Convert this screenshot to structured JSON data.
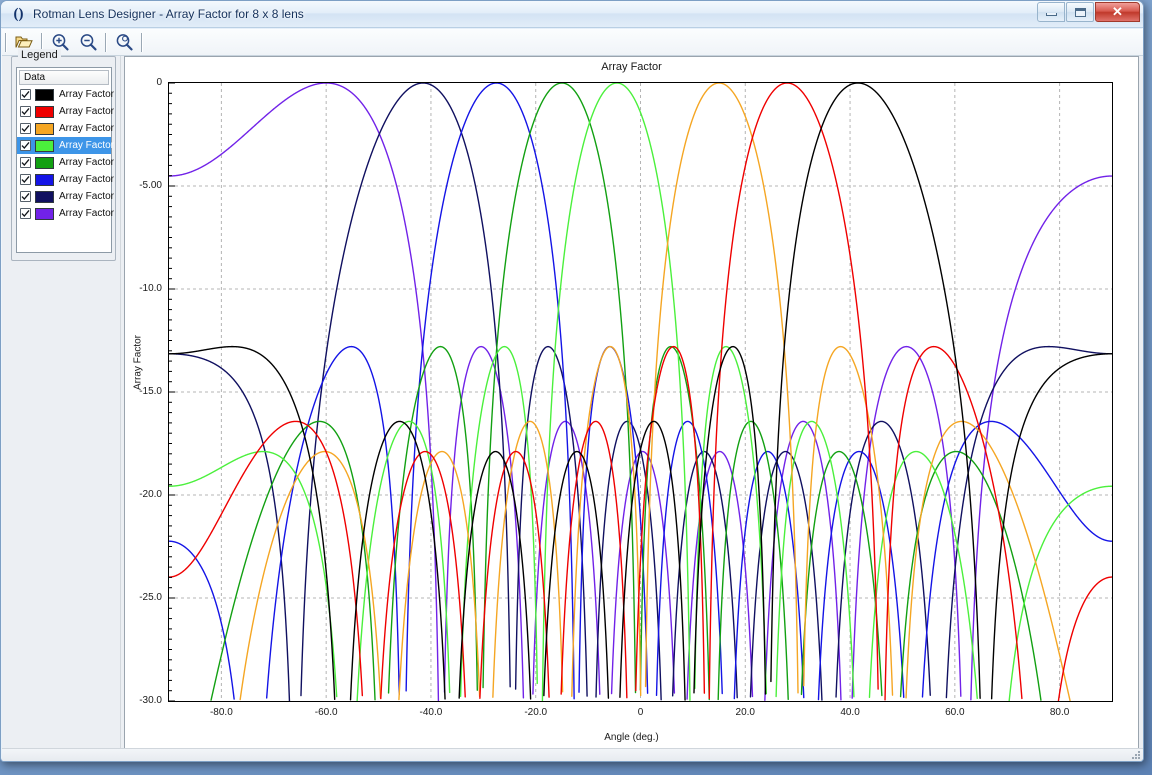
{
  "window": {
    "title": "Rotman Lens Designer - Array Factor for 8 x 8 lens",
    "icon": "lens-icon",
    "minimize_label": "Minimize",
    "maximize_label": "Maximize",
    "close_label": "✕"
  },
  "toolbar": {
    "buttons": [
      {
        "name": "open-file-button",
        "icon": "open-folder-icon",
        "tooltip": "Open"
      },
      {
        "name": "zoom-in-button",
        "icon": "zoom-in-icon",
        "tooltip": "Zoom In"
      },
      {
        "name": "zoom-out-button",
        "icon": "zoom-out-icon",
        "tooltip": "Zoom Out"
      },
      {
        "name": "zoom-reset-button",
        "icon": "zoom-reset-icon",
        "tooltip": "Reset Zoom"
      }
    ]
  },
  "legend": {
    "caption": "Legend",
    "column_header": "Data",
    "selected_index": 3,
    "items": [
      {
        "label": "Array Factor",
        "color": "#000000",
        "checked": true
      },
      {
        "label": "Array Factor",
        "color": "#ef0000",
        "checked": true
      },
      {
        "label": "Array Factor",
        "color": "#f5a623",
        "checked": true
      },
      {
        "label": "Array Factor",
        "color": "#4bf03c",
        "checked": true
      },
      {
        "label": "Array Factor",
        "color": "#12a012",
        "checked": true
      },
      {
        "label": "Array Factor",
        "color": "#1414e6",
        "checked": true
      },
      {
        "label": "Array Factor",
        "color": "#101060",
        "checked": true
      },
      {
        "label": "Array Factor",
        "color": "#7122e8",
        "checked": true
      }
    ]
  },
  "chart_data": {
    "type": "line",
    "title": "Array Factor",
    "xlabel": "Angle (deg.)",
    "ylabel": "Array Factor",
    "xlim": [
      -90,
      90
    ],
    "ylim": [
      -30,
      0
    ],
    "grid": true,
    "legend_position": "external-left",
    "xticks": [
      -80,
      -60,
      -40,
      -20,
      0,
      20,
      40,
      60,
      80
    ],
    "xtick_labels": [
      "-80.0",
      "-60.0",
      "-40.0",
      "-20.0",
      "0",
      "20.0",
      "40.0",
      "60.0",
      "80.0"
    ],
    "yticks": [
      0,
      -5,
      -10,
      -15,
      -20,
      -25,
      -30
    ],
    "ytick_labels": [
      "0",
      "-5.00",
      "-10.0",
      "-15.0",
      "-20.0",
      "-25.0",
      "-30.0"
    ],
    "n_elements": 8,
    "series": [
      {
        "name": "Array Factor",
        "color": "#7122e8",
        "beam_peak_deg": -60.0,
        "peak_db": 0.0,
        "first_sidelobe_db": -13.3
      },
      {
        "name": "Array Factor",
        "color": "#101060",
        "beam_peak_deg": -41.5,
        "peak_db": 0.0,
        "first_sidelobe_db": -13.3
      },
      {
        "name": "Array Factor",
        "color": "#1414e6",
        "beam_peak_deg": -27.5,
        "peak_db": 0.0,
        "first_sidelobe_db": -13.3
      },
      {
        "name": "Array Factor",
        "color": "#12a012",
        "beam_peak_deg": -15.0,
        "peak_db": 0.0,
        "first_sidelobe_db": -13.3
      },
      {
        "name": "Array Factor",
        "color": "#4bf03c",
        "beam_peak_deg": -4.5,
        "peak_db": 0.0,
        "first_sidelobe_db": -13.3
      },
      {
        "name": "Array Factor",
        "color": "#f5a623",
        "beam_peak_deg": 15.0,
        "peak_db": 0.0,
        "first_sidelobe_db": -13.3
      },
      {
        "name": "Array Factor",
        "color": "#ef0000",
        "beam_peak_deg": 28.0,
        "peak_db": 0.0,
        "first_sidelobe_db": -13.3
      },
      {
        "name": "Array Factor",
        "color": "#000000",
        "beam_peak_deg": 41.5,
        "peak_db": 0.0,
        "first_sidelobe_db": -13.3
      }
    ]
  }
}
